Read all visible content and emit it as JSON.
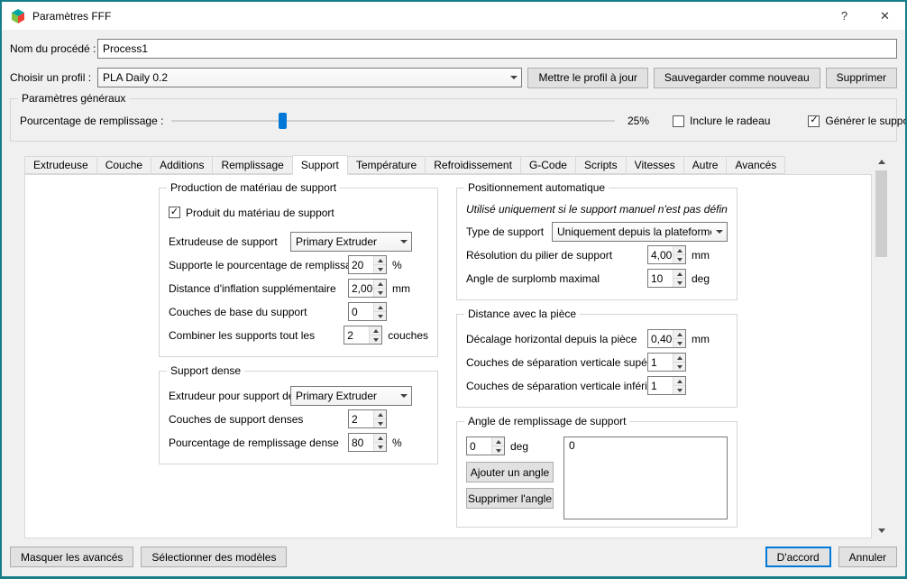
{
  "colors": {
    "accent_blue": "#0078d7",
    "window_border_teal": "#177d89"
  },
  "window": {
    "title": "Paramètres FFF",
    "help": "?",
    "close": "✕"
  },
  "header": {
    "process_label": "Nom du procédé :",
    "process_value": "Process1",
    "profile_label": "Choisir un profil :",
    "profile_value": "PLA Daily 0.2",
    "update_button": "Mettre le profil à jour",
    "save_new_button": "Sauvegarder comme nouveau",
    "delete_button": "Supprimer"
  },
  "general": {
    "title": "Paramètres généraux",
    "infill_label": "Pourcentage de remplissage :",
    "infill_percent": "25%",
    "raft_label": "Inclure le radeau",
    "support_label": "Générer le support"
  },
  "tabs": [
    "Extrudeuse",
    "Couche",
    "Additions",
    "Remplissage",
    "Support",
    "Température",
    "Refroidissement",
    "G-Code",
    "Scripts",
    "Vitesses",
    "Autre",
    "Avancés"
  ],
  "support": {
    "generation": {
      "title": "Production de matériau de support",
      "checkbox": "Produit du matériau de support",
      "extruder_label": "Extrudeuse de support",
      "extruder_value": "Primary Extruder",
      "rows": [
        {
          "label": "Supporte le pourcentage de remplissage",
          "value": "20",
          "unit": "%"
        },
        {
          "label": "Distance d'inflation supplémentaire",
          "value": "2,00",
          "unit": "mm"
        },
        {
          "label": "Couches de base du support",
          "value": "0",
          "unit": ""
        },
        {
          "label": "Combiner les supports tout les",
          "value": "2",
          "unit": "couches"
        }
      ]
    },
    "dense": {
      "title": "Support dense",
      "extruder_label": "Extrudeur pour support dense",
      "extruder_value": "Primary Extruder",
      "rows": [
        {
          "label": "Couches de support denses",
          "value": "2",
          "unit": ""
        },
        {
          "label": "Pourcentage de remplissage dense",
          "value": "80",
          "unit": "%"
        }
      ]
    },
    "auto": {
      "title": "Positionnement automatique",
      "note": "Utilisé uniquement si le support manuel n'est pas défini",
      "type_label": "Type de support",
      "type_value": "Uniquement depuis la plateforme de co",
      "rows": [
        {
          "label": "Résolution du pilier de support",
          "value": "4,00",
          "unit": "mm"
        },
        {
          "label": "Angle de surplomb maximal",
          "value": "10",
          "unit": "deg"
        }
      ]
    },
    "distance": {
      "title": "Distance avec la pièce",
      "rows": [
        {
          "label": "Décalage horizontal depuis la pièce",
          "value": "0,40",
          "unit": "mm"
        },
        {
          "label": "Couches de séparation verticale supérieure",
          "value": "1",
          "unit": ""
        },
        {
          "label": "Couches de séparation verticale inférieure",
          "value": "1",
          "unit": ""
        }
      ]
    },
    "angles": {
      "title": "Angle de remplissage de support",
      "value": "0",
      "unit": "deg",
      "add_button": "Ajouter un angle",
      "remove_button": "Supprimer l'angle",
      "list": [
        "0"
      ]
    }
  },
  "footer": {
    "hide_advanced_button": "Masquer les avancés",
    "select_models_button": "Sélectionner des modèles",
    "ok_button": "D'accord",
    "cancel_button": "Annuler"
  }
}
